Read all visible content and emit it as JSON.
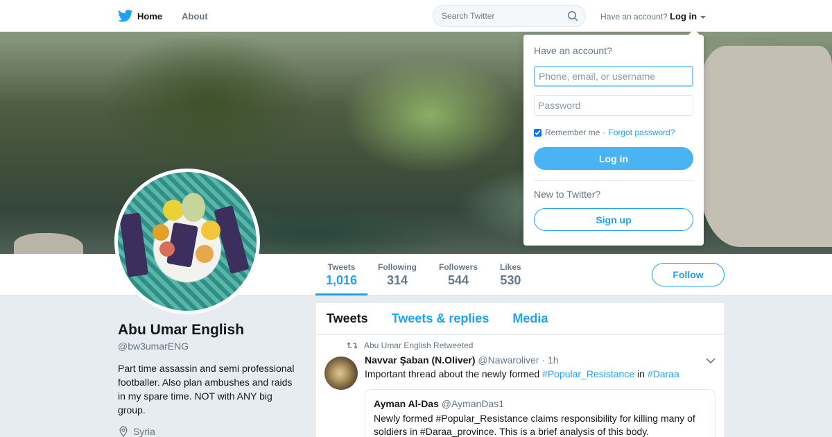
{
  "nav": {
    "home_label": "Home",
    "about_label": "About",
    "search_placeholder": "Search Twitter",
    "have_account": "Have an account?",
    "login_label": "Log in"
  },
  "profile": {
    "name": "Abu Umar English",
    "handle": "@bw3umarENG",
    "bio": "Part time assassin and semi professional footballer. Also plan ambushes and raids in my spare time. NOT with ANY big group.",
    "location": "Syria",
    "follow_label": "Follow"
  },
  "stats": [
    {
      "label": "Tweets",
      "value": "1,016",
      "active": true
    },
    {
      "label": "Following",
      "value": "314"
    },
    {
      "label": "Followers",
      "value": "544"
    },
    {
      "label": "Likes",
      "value": "530"
    }
  ],
  "timeline": {
    "tabs": [
      "Tweets",
      "Tweets & replies",
      "Media"
    ],
    "active_tab": "Tweets"
  },
  "tweet": {
    "retweet_note": "Abu Umar English Retweeted",
    "author_name": "Navvar Şaban (N.Oliver)",
    "author_handle": "@Nawaroliver",
    "time": "· 1h",
    "text_prefix": "Important thread about the newly formed ",
    "hashtag1": "#Popular_Resistance",
    "text_mid": " in ",
    "hashtag2": "#Daraa",
    "quote": {
      "name": "Ayman Al-Das",
      "handle": "@AymanDas1",
      "text": "Newly formed #Popular_Resistance claims responsibility for killing many of soldiers in #Daraa_province. This is a brief analysis of this body."
    }
  },
  "login_dropdown": {
    "title": "Have an account?",
    "username_placeholder": "Phone, email, or username",
    "password_placeholder": "Password",
    "remember_label": "Remember me",
    "separator": "·",
    "forgot_label": "Forgot password?",
    "login_button": "Log in",
    "new_to": "New to Twitter?",
    "signup_button": "Sign up",
    "remember_checked": true
  },
  "colors": {
    "brand": "#1da1f2",
    "background": "#e6ecf0",
    "muted_text": "#657786"
  },
  "icons": [
    "twitter-bird-icon",
    "search-icon",
    "caret-down-icon",
    "location-pin-icon",
    "retweet-icon",
    "chevron-down-icon"
  ]
}
